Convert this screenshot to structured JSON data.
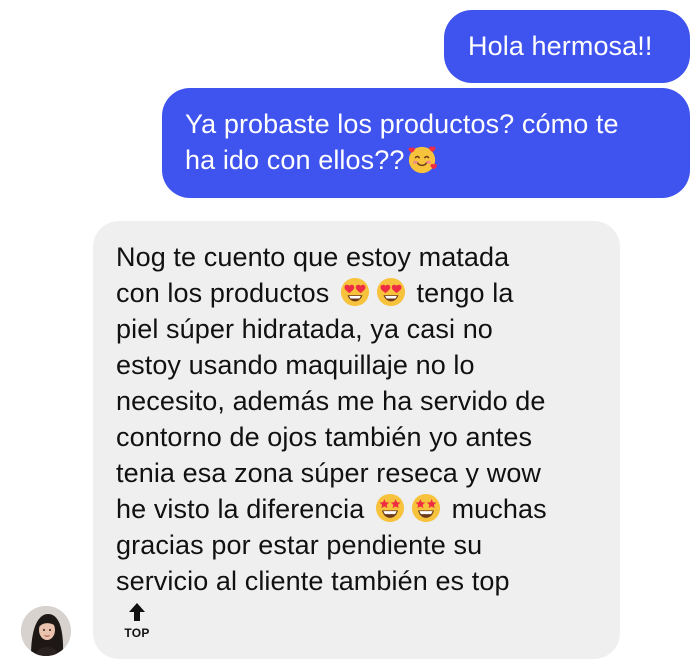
{
  "messages": {
    "outgoing_1": "Hola hermosa!!",
    "outgoing_2": {
      "text": "Ya probaste los productos? cómo te\nha ido con ellos??",
      "emoji": "smiling-face-with-hearts-emoji"
    },
    "incoming": {
      "line1": "Nog te cuento que estoy matada",
      "line2_a": "con los productos",
      "line2_b": "tengo la",
      "middle": "piel súper hidratada, ya casi no\nestoy usando maquillaje no lo\nnecesito, además me ha servido de\ncontorno de ojos también yo antes\ntenia esa zona súper reseca y wow",
      "line8_a": "he visto la diferencia",
      "line8_b": "muchas",
      "tail": "gracias por estar pendiente su\nservicio al cliente también es top",
      "emoji_1": "heart-eyes-emoji",
      "emoji_2": "star-struck-emoji"
    }
  },
  "top_button": {
    "label": "TOP",
    "icon": "arrow-up-icon"
  },
  "avatar": {
    "icon": "user-avatar"
  },
  "colors": {
    "outgoing_bubble": "#3f53ee",
    "incoming_bubble": "#efefef",
    "background": "#ffffff"
  }
}
